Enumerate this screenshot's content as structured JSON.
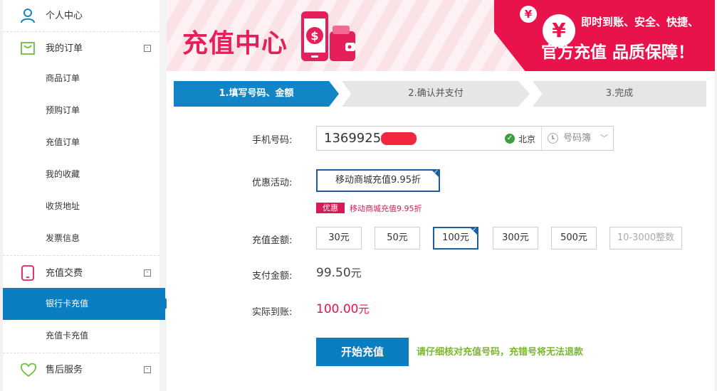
{
  "sidebar": {
    "sections": [
      {
        "label": "个人中心",
        "icon": "user-icon"
      },
      {
        "label": "我的订单",
        "icon": "bag-icon",
        "toggle": "-"
      },
      {
        "label": "充值交费",
        "icon": "phone-icon",
        "toggle": "-"
      },
      {
        "label": "售后服务",
        "icon": "heart-icon",
        "toggle": "-"
      }
    ],
    "order_items": [
      "商品订单",
      "预购订单",
      "充值订单",
      "我的收藏",
      "收货地址",
      "发票信息"
    ],
    "recharge_items": [
      "银行卡充值",
      "充值卡充值"
    ],
    "active_item": "银行卡充值"
  },
  "banner": {
    "title": "充值中心",
    "yen_symbol": "¥",
    "slogan_line1": "即时到账、安全、快捷、",
    "slogan_line2": "官方充值 品质保障！"
  },
  "steps": [
    "1.填写号码、金额",
    "2.确认并支付",
    "3.完成"
  ],
  "form": {
    "phone_label": "手机号码:",
    "phone_value": "1369925",
    "location": "北京",
    "contacts_label": "号码簿",
    "promo_label": "优惠活动:",
    "promo_option": "移动商城充值9.95折",
    "promo_tag": "优惠",
    "promo_note": "移动商城充值9.95折",
    "amount_label": "充值金额:",
    "amounts": [
      "30元",
      "50元",
      "100元",
      "300元",
      "500元"
    ],
    "custom_amount_placeholder": "10-3000整数",
    "selected_amount": "100元",
    "pay_label": "支付金额:",
    "pay_amount": "99.50",
    "pay_unit": "元",
    "arrive_label": "实际到账:",
    "arrive_amount": "100.00",
    "arrive_unit": "元",
    "submit_label": "开始充值",
    "warning": "请仔细核对充值号码，充错号将无法退款"
  },
  "colors": {
    "brand_blue": "#0b7dc1",
    "brand_red": "#e8134b",
    "warning_green": "#7ab72e"
  }
}
